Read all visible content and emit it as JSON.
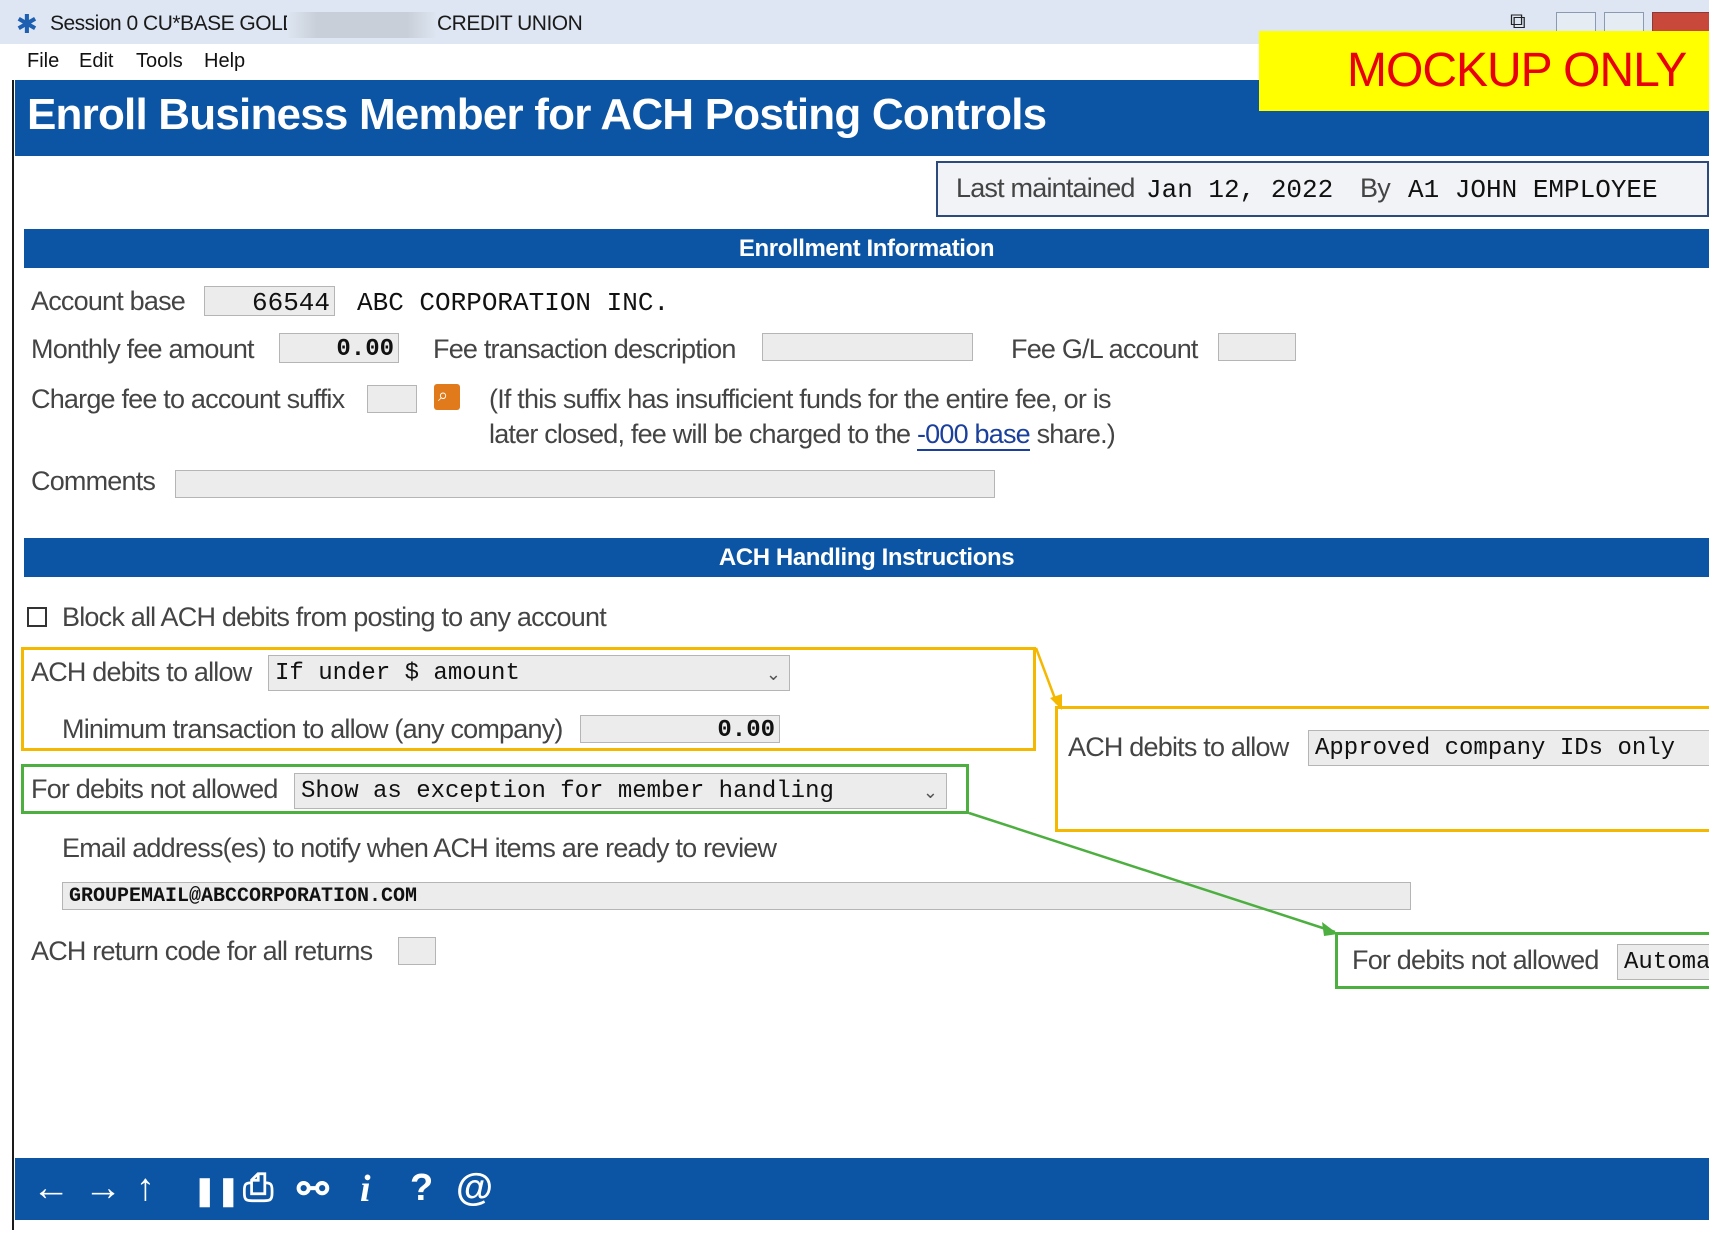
{
  "window": {
    "title_prefix": "Session 0 CU*BASE GOLD -",
    "title_suffix": "CREDIT UNION"
  },
  "menu": [
    "File",
    "Edit",
    "Tools",
    "Help"
  ],
  "page_title": "Enroll Business Member for ACH Posting Controls",
  "mockup_banner": "MOCKUP ONLY",
  "last_maintained": {
    "label": "Last maintained",
    "date": "Jan 12, 2022",
    "by_label": "By",
    "by_value": "A1 JOHN EMPLOYEE"
  },
  "enrollment": {
    "header": "Enrollment Information",
    "account_base_label": "Account base",
    "account_base": "66544",
    "account_name": "ABC CORPORATION INC.",
    "monthly_fee_label": "Monthly fee amount",
    "monthly_fee": "0.00",
    "fee_desc_label": "Fee transaction description",
    "fee_desc": "",
    "fee_gl_label": "Fee G/L account",
    "fee_gl": "",
    "charge_suffix_label": "Charge fee to account suffix",
    "charge_suffix": "",
    "note_line1": "(If this suffix has insufficient funds for the entire fee, or is",
    "note_line2_pre": "later closed, fee will be charged to the",
    "note_link": "-000 base",
    "note_line2_post": "share.)",
    "comments_label": "Comments",
    "comments": ""
  },
  "ach": {
    "header": "ACH Handling Instructions",
    "block_all_label": "Block all ACH debits from posting to any account",
    "block_all_checked": false,
    "debits_allow_label": "ACH debits to allow",
    "debits_allow_value": "If under $ amount",
    "min_txn_label": "Minimum transaction to allow (any company)",
    "min_txn_value": "0.00",
    "not_allowed_label": "For debits not allowed",
    "not_allowed_value": "Show as exception for member handling",
    "email_label": "Email address(es) to notify when ACH items are ready to review",
    "email_value": "GROUPEMAIL@ABCCORPORATION.COM",
    "return_code_label": "ACH return code for all returns",
    "return_code": ""
  },
  "callouts": {
    "alt_debits_label": "ACH debits to allow",
    "alt_debits_value": "Approved company IDs only",
    "alt_not_allowed_label": "For debits not allowed",
    "alt_not_allowed_value": "Automa",
    "yellow": "#f5b800",
    "green": "#4caf3f"
  },
  "toolbar": {
    "icons": [
      "back-arrow-icon",
      "forward-arrow-icon",
      "up-arrow-icon",
      "pause-icon",
      "print-icon",
      "link-icon",
      "info-icon",
      "help-icon",
      "email-icon"
    ]
  },
  "colors": {
    "band_blue": "#0b55a4",
    "mockup_yellow": "#ffff00",
    "mockup_red": "#e8000b"
  }
}
